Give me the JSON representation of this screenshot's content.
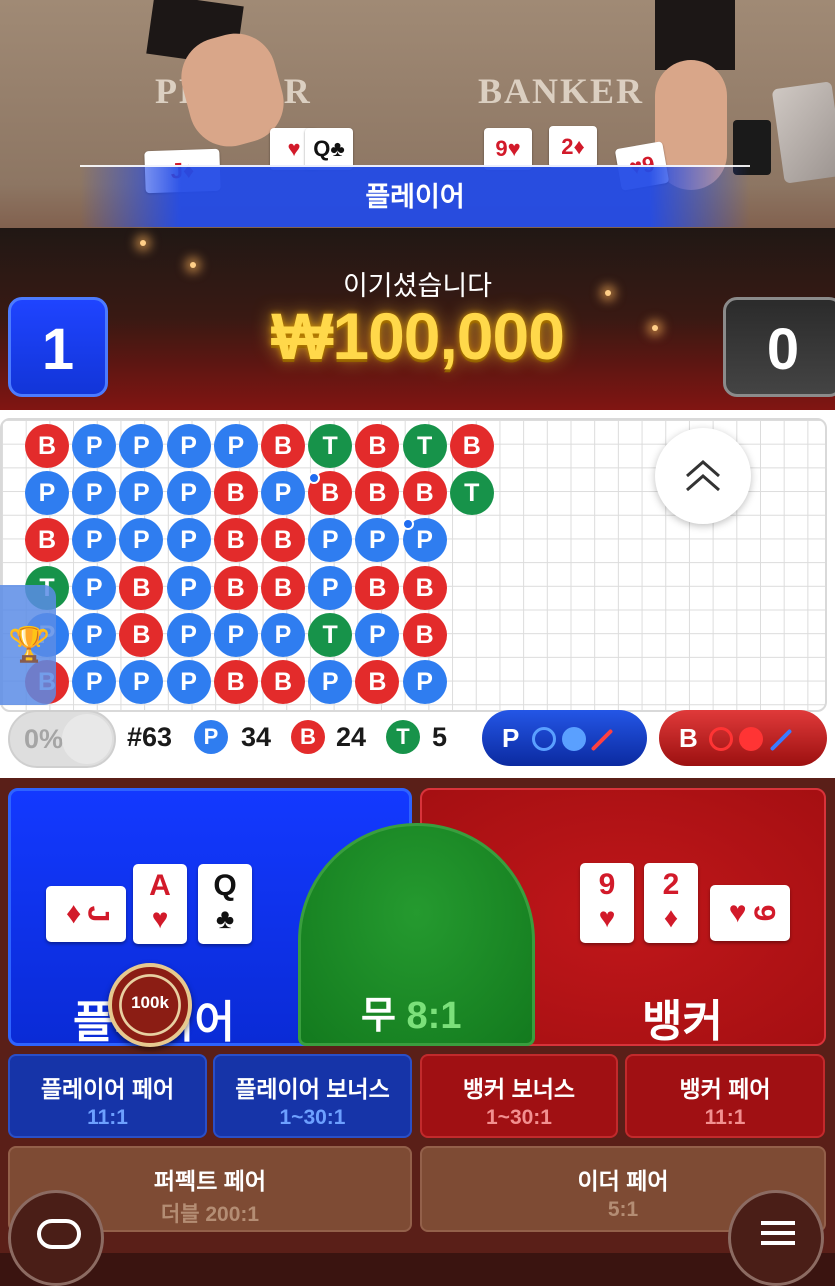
{
  "video": {
    "felt_player": "PLAYER",
    "felt_banker": "BANKER",
    "result_label": "플레이어",
    "win_title": "이기셨습니다",
    "win_amount": "₩100,000",
    "player_score": "1",
    "banker_score": "0"
  },
  "roadmap": {
    "columns": [
      [
        "B",
        "P",
        "B",
        "T",
        "P",
        "B"
      ],
      [
        "P",
        "P",
        "P",
        "P",
        "P",
        "P"
      ],
      [
        "P",
        "P",
        "P",
        "B",
        "B",
        "P"
      ],
      [
        "P",
        "P",
        "P",
        "P",
        "P",
        "P"
      ],
      [
        "P",
        "B",
        "B",
        "B",
        "P",
        "B"
      ],
      [
        "B",
        "P",
        "B",
        "B",
        "P",
        "B"
      ],
      [
        "T",
        "B",
        "P",
        "P",
        "T",
        "P"
      ],
      [
        "B",
        "B",
        "P",
        "B",
        "P",
        "B"
      ],
      [
        "T",
        "B",
        "P",
        "B",
        "B",
        "P"
      ],
      [
        "B",
        "T",
        "",
        "",
        "",
        ""
      ]
    ],
    "stats": {
      "toggle_percent": "0%",
      "round": "#63",
      "player_letter": "P",
      "player_count": "34",
      "banker_letter": "B",
      "banker_count": "24",
      "tie_letter": "T",
      "tie_count": "5"
    },
    "predict_player": "P",
    "predict_banker": "B"
  },
  "bets": {
    "player_label": "플레이어",
    "tie_label": "무",
    "tie_odds": "8:1",
    "banker_label": "뱅커",
    "chip_value": "100k",
    "player_cards": [
      {
        "rank": "J",
        "suit": "♦",
        "color": "red"
      },
      {
        "rank": "A",
        "suit": "♥",
        "color": "red"
      },
      {
        "rank": "Q",
        "suit": "♣",
        "color": "black"
      }
    ],
    "banker_cards": [
      {
        "rank": "9",
        "suit": "♥",
        "color": "red"
      },
      {
        "rank": "2",
        "suit": "♦",
        "color": "red"
      },
      {
        "rank": "9",
        "suit": "♥",
        "color": "red"
      }
    ],
    "side_bets": [
      {
        "name": "플레이어 페어",
        "odds": "11:1"
      },
      {
        "name": "플레이어 보너스",
        "odds": "1~30:1"
      },
      {
        "name": "뱅커 보너스",
        "odds": "1~30:1"
      },
      {
        "name": "뱅커 페어",
        "odds": "11:1"
      },
      {
        "name": "퍼펙트 페어",
        "odds": "더블 200:1"
      },
      {
        "name": "이더 페어",
        "odds": "5:1"
      }
    ]
  },
  "colors": {
    "player_blue": "#1339ff",
    "banker_red": "#c0171a",
    "tie_green": "#137a1e",
    "win_gold": "#ffd84a"
  }
}
